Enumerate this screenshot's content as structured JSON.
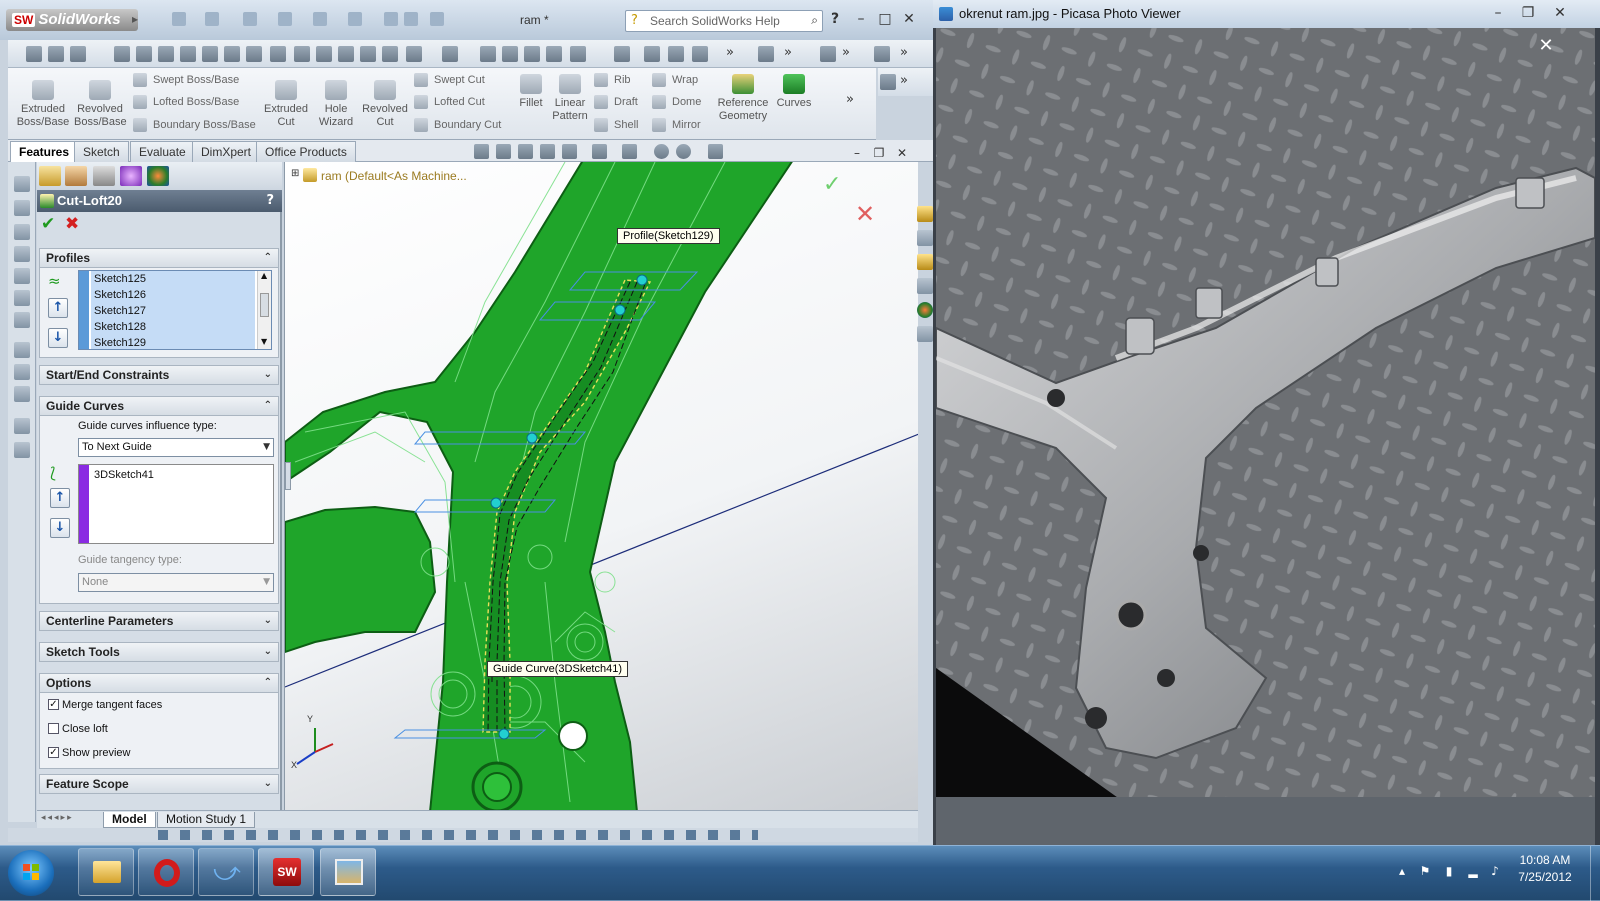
{
  "solidworks": {
    "app_name": "SolidWorks",
    "document_title": "ram *",
    "search_placeholder": "Search SolidWorks Help",
    "ribbon": {
      "extruded_boss": "Extruded Boss/Base",
      "revolved_boss": "Revolved Boss/Base",
      "swept_boss": "Swept Boss/Base",
      "lofted_boss": "Lofted Boss/Base",
      "boundary_boss": "Boundary Boss/Base",
      "extruded_cut": "Extruded Cut",
      "hole_wizard": "Hole Wizard",
      "revolved_cut": "Revolved Cut",
      "swept_cut": "Swept Cut",
      "lofted_cut": "Lofted Cut",
      "boundary_cut": "Boundary Cut",
      "fillet": "Fillet",
      "linear_pattern": "Linear Pattern",
      "rib": "Rib",
      "draft": "Draft",
      "shell": "Shell",
      "wrap": "Wrap",
      "dome": "Dome",
      "mirror": "Mirror",
      "reference_geometry": "Reference Geometry",
      "curves": "Curves"
    },
    "tabs": [
      "Features",
      "Sketch",
      "Evaluate",
      "DimXpert",
      "Office Products"
    ],
    "tree_root": "ram  (Default<As Machine...",
    "property_manager": {
      "title": "Cut-Loft20",
      "profiles_header": "Profiles",
      "profiles": [
        "Sketch125",
        "Sketch126",
        "Sketch127",
        "Sketch128",
        "Sketch129"
      ],
      "start_end_header": "Start/End Constraints",
      "guide_curves_header": "Guide Curves",
      "guide_influence_label": "Guide curves influence type:",
      "guide_influence_value": "To Next Guide",
      "guide_curves": [
        "3DSketch41"
      ],
      "guide_tangency_label": "Guide tangency type:",
      "guide_tangency_value": "None",
      "centerline_header": "Centerline Parameters",
      "sketch_tools_header": "Sketch Tools",
      "options_header": "Options",
      "options": [
        {
          "label": "Merge tangent faces",
          "checked": true
        },
        {
          "label": "Close loft",
          "checked": false
        },
        {
          "label": "Show preview",
          "checked": true
        }
      ],
      "feature_scope_header": "Feature Scope"
    },
    "viewport": {
      "profile_callout": "Profile(Sketch129)",
      "guide_callout": "Guide Curve(3DSketch41)",
      "triad_y": "Y",
      "triad_x": "X"
    },
    "model_tabs": [
      "Model",
      "Motion Study 1"
    ]
  },
  "picasa": {
    "title": "okrenut ram.jpg - Picasa Photo Viewer"
  },
  "taskbar": {
    "time": "10:08 AM",
    "date": "7/25/2012"
  },
  "colors": {
    "model_green": "#1fa52a",
    "ui_blue": "#4b5b6e",
    "check_green": "#1f9a1f",
    "cancel_red": "#d42020"
  }
}
